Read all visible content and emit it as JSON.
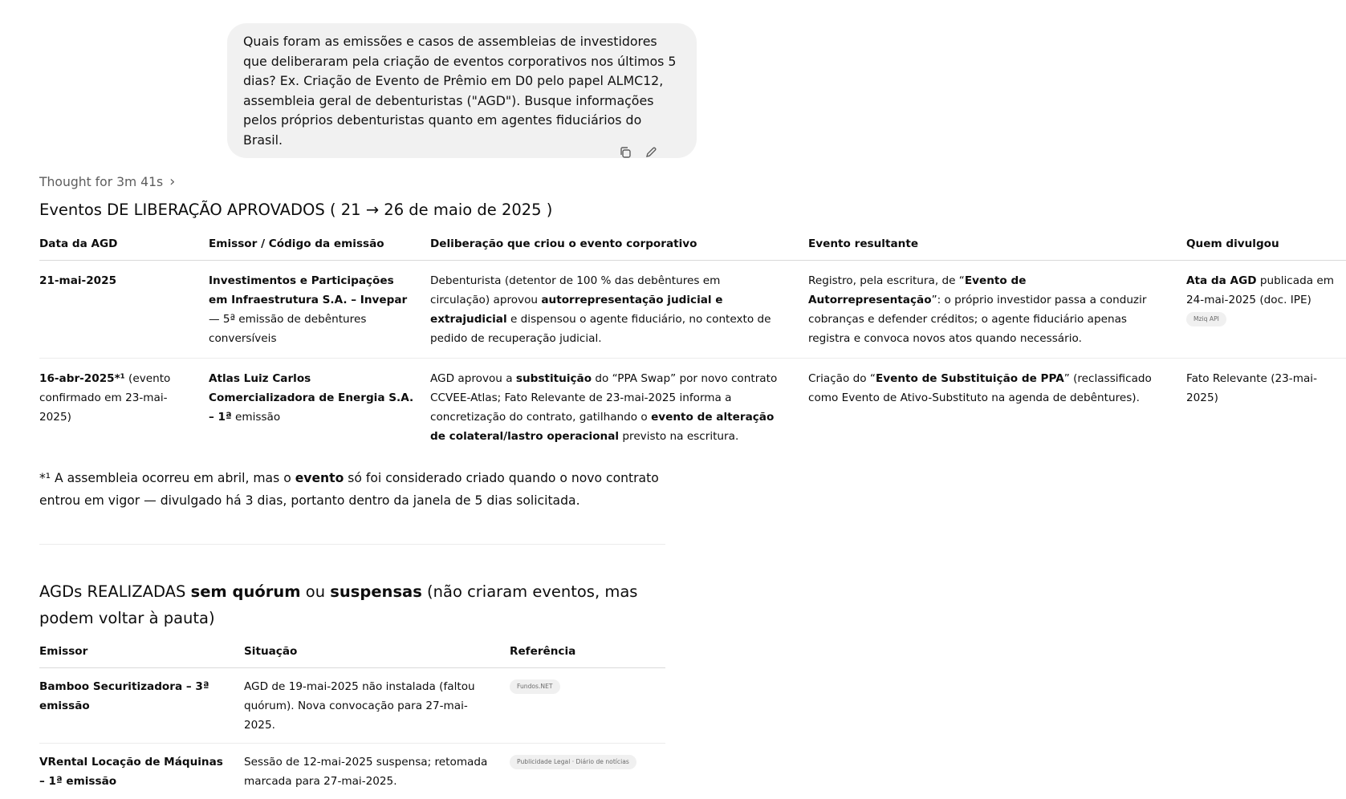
{
  "user_message": "Quais foram as emissões e casos de assembleias de investidores que deliberaram pela criação de eventos corporativos nos últimos 5 dias? Ex. Criação de Evento de Prêmio em D0 pelo papel ALMC12, assembleia geral de debenturistas (\"AGD\"). Busque informações pelos próprios debenturistas quanto em agentes fiduciários do Brasil.",
  "message_actions": {
    "copy_icon": "copy-icon",
    "edit_icon": "edit-icon"
  },
  "thought": {
    "label": "Thought for 3m 41s",
    "chevron": "›"
  },
  "section1": {
    "title": "Eventos DE LIBERAÇÃO APROVADOS ( 21 → 26 de maio de 2025 )",
    "headers": [
      "Data da AGD",
      "Emissor / Código da emissão",
      "Deliberação que criou o evento corporativo",
      "Evento resultante",
      "Quem divulgou"
    ],
    "rows": [
      {
        "date": "21-mai-2025",
        "issuer_bold": "Investimentos e Participações em Infraestrutura S.A. – Invepar",
        "issuer_rest": " — 5ª emissão de debêntures conversíveis",
        "delib_1": "Debenturista (detentor de 100 % das debêntures em circulação) aprovou ",
        "delib_bold": "autorrepresentação judicial e extrajudicial",
        "delib_2": " e dispensou o agente fiduciário, no contexto de pedido de recuperação judicial.",
        "event_1": "Registro, pela escritura, de “",
        "event_bold": "Evento de Autorrepresentação",
        "event_2": "”: o próprio investidor passa a conduzir cobranças e defender créditos; o agente fiduciário apenas registra e convoca novos atos quando necessário.",
        "source_bold": "Ata da AGD",
        "source_rest": " publicada em 24-mai-2025 (doc. IPE) ",
        "source_pill": "Mziq API"
      },
      {
        "date_bold": "16-abr-2025*¹",
        "date_rest": " (evento confirmado em 23-mai-2025)",
        "issuer_bold": "Atlas Luiz Carlos Comercializadora de Energia S.A. – 1ª",
        "issuer_rest": " emissão",
        "delib_1": "AGD aprovou a ",
        "delib_bold1": "substituição",
        "delib_2": " do “PPA Swap” por novo contrato CCVEE-Atlas; Fato Relevante de 23-mai-2025 informa a concretização do contrato, gatilhando o ",
        "delib_bold2": "evento de alteração de colateral/lastro operacional",
        "delib_3": " previsto na escritura.",
        "event_1": "Criação do “",
        "event_bold": "Evento de Substituição de PPA",
        "event_2": "” (reclassificado como Evento de Ativo-Substituto na agenda de debêntures).",
        "source": "Fato Relevante (23-mai-2025)"
      }
    ],
    "note_1": "*¹ A assembleia ocorreu em abril, mas o ",
    "note_bold": "evento",
    "note_2": " só foi considerado criado quando o novo contrato entrou em vigor — divulgado há 3 dias, portanto dentro da janela de 5 dias solicitada."
  },
  "section2": {
    "title_1": "AGDs REALIZADAS ",
    "title_bold1": "sem quórum",
    "title_2": " ou ",
    "title_bold2": "suspensas",
    "title_3": " (não criaram eventos, mas podem voltar à pauta)",
    "headers": [
      "Emissor",
      "Situação",
      "Referência"
    ],
    "rows": [
      {
        "issuer": "Bamboo Securitizadora – 3ª emissão",
        "status": "AGD de 19-mai-2025 não instalada (faltou quórum). Nova convocação para 27-mai-2025.",
        "ref": "Fundos.NET"
      },
      {
        "issuer": "VRental Locação de Máquinas – 1ª emissão",
        "status": "Sessão de 12-mai-2025 suspensa; retomada marcada para 27-mai-2025.",
        "ref": "Publicidade Legal · Diário de notícias"
      }
    ]
  }
}
